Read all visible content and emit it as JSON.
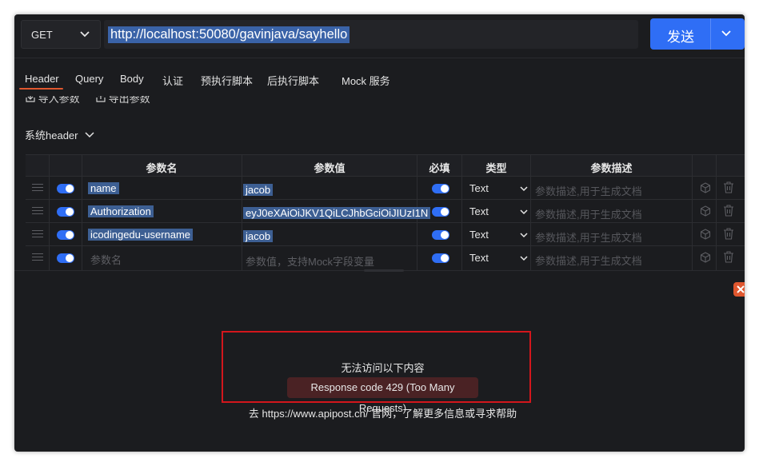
{
  "request": {
    "method": "GET",
    "url": "http://localhost:50080/gavinjava/sayhello",
    "send_label": "发送"
  },
  "tabs": [
    {
      "label": "Header",
      "active": true
    },
    {
      "label": "Query"
    },
    {
      "label": "Body"
    },
    {
      "label": "认证"
    },
    {
      "label": "预执行脚本"
    },
    {
      "label": "后执行脚本"
    },
    {
      "label": "Mock 服务"
    }
  ],
  "actions": {
    "import_label": "导入参数",
    "export_label": "导出参数"
  },
  "system_header_label": "系统header",
  "table": {
    "columns": {
      "name": "参数名",
      "value": "参数值",
      "required": "必填",
      "type": "类型",
      "description": "参数描述"
    },
    "rows": [
      {
        "name": "name",
        "value": "jacob",
        "enabled": true,
        "required": true,
        "type": "Text",
        "description_placeholder": "参数描述,用于生成文档"
      },
      {
        "name": "Authorization",
        "value": "eyJ0eXAiOiJKV1QiLCJhbGciOiJIUzI1N",
        "enabled": true,
        "required": true,
        "type": "Text",
        "description_placeholder": "参数描述,用于生成文档"
      },
      {
        "name": "icodingedu-username",
        "value": "jacob",
        "enabled": true,
        "required": true,
        "type": "Text",
        "description_placeholder": "参数描述,用于生成文档"
      }
    ],
    "new_row": {
      "name_placeholder": "参数名",
      "value_placeholder": "参数值，支持Mock字段变量",
      "type": "Text",
      "description_placeholder": "参数描述,用于生成文档"
    }
  },
  "response": {
    "message": "无法访问以下内容",
    "error_code": "Response code 429 (Too Many Requests)",
    "help_text": "去 https://www.apipost.cn/ 官网，了解更多信息或寻求帮助"
  },
  "colors": {
    "accent_blue": "#2f6ef5",
    "active_tab_underline": "#e0572f",
    "annotation_red": "#d3161c"
  }
}
